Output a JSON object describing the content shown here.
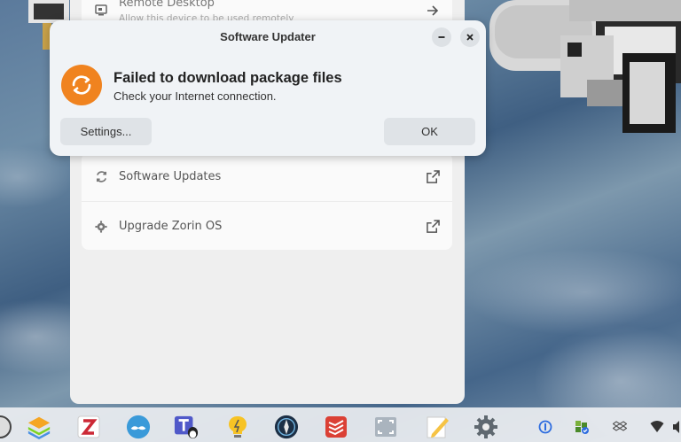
{
  "background_panel": {
    "top_row": {
      "label": "Remote Desktop",
      "sublabel": "Allow this device to be used remotely",
      "icon": "remote-desktop-icon",
      "action_icon": "arrow-right-icon"
    },
    "rows": [
      {
        "label": "Software Updates",
        "icon": "refresh-icon",
        "action_icon": "external-link-icon"
      },
      {
        "label": "Upgrade Zorin OS",
        "icon": "gear-icon",
        "action_icon": "external-link-icon"
      }
    ]
  },
  "dialog": {
    "title": "Software Updater",
    "heading": "Failed to download package files",
    "message": "Check your Internet connection.",
    "settings_button": "Settings...",
    "ok_button": "OK",
    "icon": "software-updater-icon",
    "accent_color": "#f0831f"
  },
  "taskbar": {
    "apps": [
      "layers-app-icon",
      "zotero-app-icon",
      "mustache-app-icon",
      "teams-linux-app-icon",
      "lightbulb-app-icon",
      "compass-app-icon",
      "todoist-app-icon",
      "screenshot-app-icon",
      "text-editor-app-icon",
      "settings-app-icon"
    ],
    "tray": [
      "password-manager-tray-icon",
      "sync-tray-icon",
      "dropbox-tray-icon",
      "wifi-tray-icon",
      "volume-tray-icon"
    ]
  }
}
